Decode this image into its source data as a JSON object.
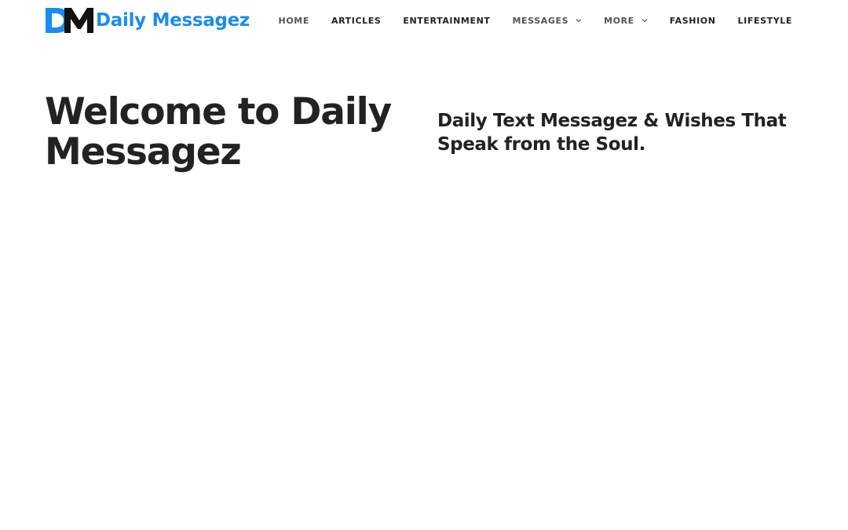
{
  "brand": {
    "name": "Daily Messagez",
    "primary_color": "#1a8cf0",
    "mark_color": "#111111",
    "mark_icon": "dm-monogram-icon"
  },
  "nav": {
    "items": [
      {
        "label": "HOME",
        "has_dropdown": false
      },
      {
        "label": "ARTICLES",
        "has_dropdown": false
      },
      {
        "label": "ENTERTAINMENT",
        "has_dropdown": false
      },
      {
        "label": "MESSAGES",
        "has_dropdown": true
      },
      {
        "label": "MORE",
        "has_dropdown": true
      },
      {
        "label": "FASHION",
        "has_dropdown": false
      },
      {
        "label": "LIFESTYLE",
        "has_dropdown": false
      }
    ],
    "dropdown_icon": "chevron-down-icon"
  },
  "hero": {
    "title": "Welcome to Daily Messagez",
    "subtitle": "Daily Text Messagez & Wishes That Speak from the Soul."
  },
  "colors": {
    "text": "#222222",
    "nav_muted": "#555555",
    "background": "#ffffff"
  }
}
